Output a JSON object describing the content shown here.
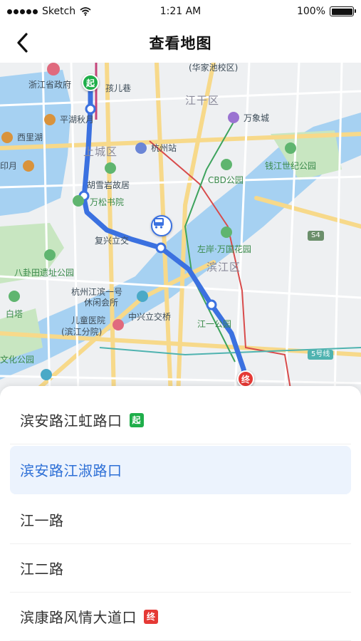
{
  "status_bar": {
    "carrier": "Sketch",
    "time": "1:21 AM",
    "battery": "100%",
    "battery_level": 1.0
  },
  "nav": {
    "title": "查看地图",
    "back_icon": "chevron-left-icon"
  },
  "map": {
    "districts": [
      "上城区",
      "江干区",
      "滨江区"
    ],
    "labels": {
      "huajiachi": "(华家池校区)",
      "zhejiang_gov": "浙江省政府",
      "haier": "孩儿巷",
      "pinghu": "平湖秋月",
      "xixihu": "西里湖",
      "hangzhou_station": "杭州站",
      "wanxiangcheng": "万象城",
      "qianjiang_park": "钱江世纪公园",
      "hu_xueyan": "胡雪岩故居",
      "yin_yue": "印月",
      "wansong": "万松书院",
      "cbd_park": "CBD公园",
      "fuxing_overpass": "复兴立交",
      "zuoan_park": "左岸·万国花园",
      "bagua_park": "八卦田遗址公园",
      "binjiang_club": "杭州江滨一号",
      "club_line2": "休闲会所",
      "children_hospital": "儿童医院",
      "hospital_line2": "(滨江分院)",
      "zhongxing": "中兴立交桥",
      "jiangyi_park": "江一公园",
      "baita": "白塔",
      "culture_park": "文化公园",
      "road_s4": "S4",
      "metro_line5": "5号线"
    },
    "start_marker": "起",
    "end_marker": "终"
  },
  "stops": [
    {
      "name": "滨安路江虹路口",
      "badge": "起",
      "badge_type": "start",
      "active": false
    },
    {
      "name": "滨安路江淑路口",
      "badge": "",
      "badge_type": "",
      "active": true
    },
    {
      "name": "江一路",
      "badge": "",
      "badge_type": "",
      "active": false
    },
    {
      "name": "江二路",
      "badge": "",
      "badge_type": "",
      "active": false
    },
    {
      "name": "滨康路风情大道口",
      "badge": "终",
      "badge_type": "end",
      "active": false
    }
  ],
  "colors": {
    "route": "#3b71e0",
    "start": "#1fae4a",
    "end": "#e53935",
    "water": "#a6d1f2",
    "park": "#c8e6c1",
    "highlight_bg": "#ecf3fd",
    "highlight_text": "#2d6fd6"
  }
}
